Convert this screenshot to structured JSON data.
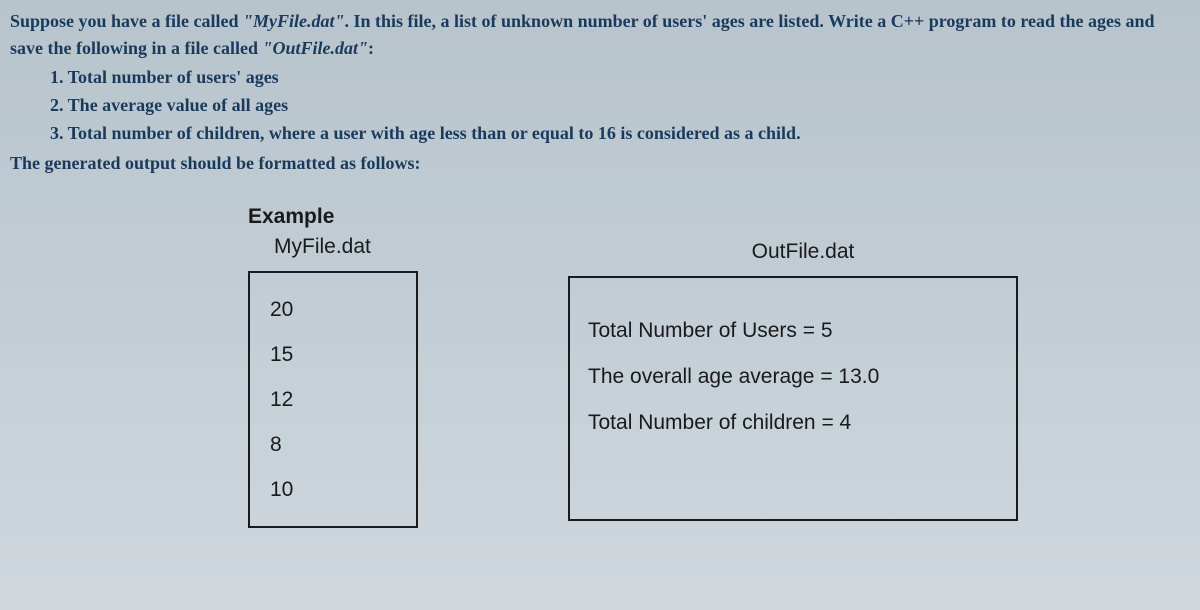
{
  "intro": {
    "part1": "Suppose you have a file called ",
    "file1": "\"MyFile.dat\"",
    "part2": ". In this file, a list of unknown number of users' ages are listed. Write a C++ program to read the ages and save the following in a file called ",
    "file2": "\"OutFile.dat\"",
    "part3": ":"
  },
  "items": {
    "i1": "1. Total number of users' ages",
    "i2": "2. The average value of all ages",
    "i3a": "3. Total number of children, where a user with age less than or equal to ",
    "i3b": "16",
    "i3c": " is considered as a child."
  },
  "followup": "The generated output should be formatted as follows:",
  "example": {
    "label": "Example",
    "input_file": "MyFile.dat",
    "output_file": "OutFile.dat",
    "input_values": [
      "20",
      "15",
      "12",
      "8",
      "10"
    ],
    "output_lines": [
      "Total Number of Users = 5",
      "The overall age average = 13.0",
      "Total Number of children = 4"
    ]
  }
}
